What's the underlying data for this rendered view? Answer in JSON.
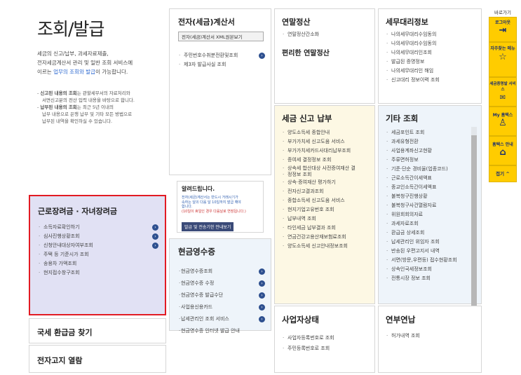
{
  "header": {
    "title": "조회/발급",
    "desc1": "세금의 신고/납부, 과세자료제출,",
    "desc2": "전자세금계산서 관리 및 일반 조회 서비스에",
    "desc3a": "이르는 ",
    "desc3b": "업무의 조회와 발급",
    "desc3c": "이 가능합니다.",
    "note1a": "신고된 내용의 조회",
    "note1b": "는 관할세무서의 자료처리와",
    "note1c": "서면신고분의 전산 입력 내용을 바탕으로 합니다.",
    "note2a": "납부된 내용의 조회",
    "note2b": "는 최근 5년 이내의",
    "note2c": "납부 내용으로 은행 납부 및 기타 모든 방법으로",
    "note2d": "납부된 내역을 확인하실 수 있습니다."
  },
  "etax": {
    "title": "전자(세금)계산서",
    "btn": "전자(세금)계산서 XML원본보기",
    "items": [
      "주민번호수취분전환및조회",
      "제3자 발급사실 조회"
    ]
  },
  "yearend": {
    "title": "연말정산",
    "items": [
      "연말정산간소화"
    ],
    "subtitle": "편리한 연말정산"
  },
  "agent": {
    "title": "세무대리정보",
    "items": [
      "나의세무대리수임동의",
      "나의세무대리수임동의",
      "나의세무대리인조회",
      "발급된 증명정보",
      "나의세무대리인 해임",
      "신고대리 정보이력 조회"
    ]
  },
  "taxreport": {
    "title": "세금 신고 납부",
    "items": [
      "양도소득세 종합안내",
      "부가가치세 신고도움 서비스",
      "부가가치세카드사대리납부조회",
      "증여세 결정정보 조회",
      "상속세 합산대상 사전증여재산 결",
      "정정보 조회",
      "상속·증여재산 평가하기",
      "전자신고결과조회",
      "종합소득세 신고도움 서비스",
      "현지기업고유번호 조회",
      "납부내역 조회",
      "타인세금 납부결과 조회",
      "연금건강고용산재보험료조회",
      "양도소득세 신고안내정보조회"
    ]
  },
  "other": {
    "title": "기타 조회",
    "items": [
      "세금포인트 조회",
      "과세유형전환",
      "사업용계좌신고현황",
      "주류면허정보",
      "기준·단순 경비율(업종코드)",
      "근로소득간이세액표",
      "종교인소득간이세액표",
      "불복청구진행상황",
      "불복청구사건열람자료",
      "위원회회의자료",
      "과세자료조회",
      "환급금 상세조회",
      "납세관리인 위임자 조회",
      "반송된 우편고지서 내역",
      "서면(방문,우편등) 접수현황조회",
      "상속인국세정보조회",
      "전통시장 정보 조회"
    ]
  },
  "notice": {
    "title": "알려드립니다.",
    "line1": "전자(세금)계산서는 반드시 거래시기가",
    "line2": "속하는 달의 다음 달 10일까지 발급 해야",
    "line3": "합니다.",
    "line4": "(10일이 휴일인 경우 다음날로 연장됩니다.)",
    "btn": "발급 및 전송기한 안내보기"
  },
  "labor": {
    "title": "근로장려금 · 자녀장려금",
    "items": [
      "소득자료확인하기",
      "심사진행상황조회",
      "신청안내대상자여부조회",
      "주택 등 기준시가 조회",
      "송용차 가액조회",
      "현지접수창구조회"
    ]
  },
  "cash": {
    "title": "현금영수증",
    "items": [
      "현금영수증조회",
      "현금영수증 수정",
      "현금영수증 발급수단",
      "사업용신용카드",
      "납세관리인 조회 서비스",
      "현금영수증 인터넷 발급 안내"
    ]
  },
  "refund": {
    "title": "국세 환급금 찾기"
  },
  "ebill": {
    "title": "전자고지 열람"
  },
  "biz": {
    "title": "사업자상태",
    "items": [
      "사업자등록번호로 조회",
      "주민등록번호로 조회"
    ]
  },
  "pension": {
    "title": "연부연납",
    "items": [
      "허가내역 조회"
    ]
  },
  "quick": {
    "heading": "바로가기",
    "logout": "로그아웃",
    "faq": "자주찾는 메뉴",
    "cert": "세금증명발 서비스",
    "mytax": "My 홈택스",
    "hometax": "홈택스 안내",
    "close": "접기 ^"
  }
}
